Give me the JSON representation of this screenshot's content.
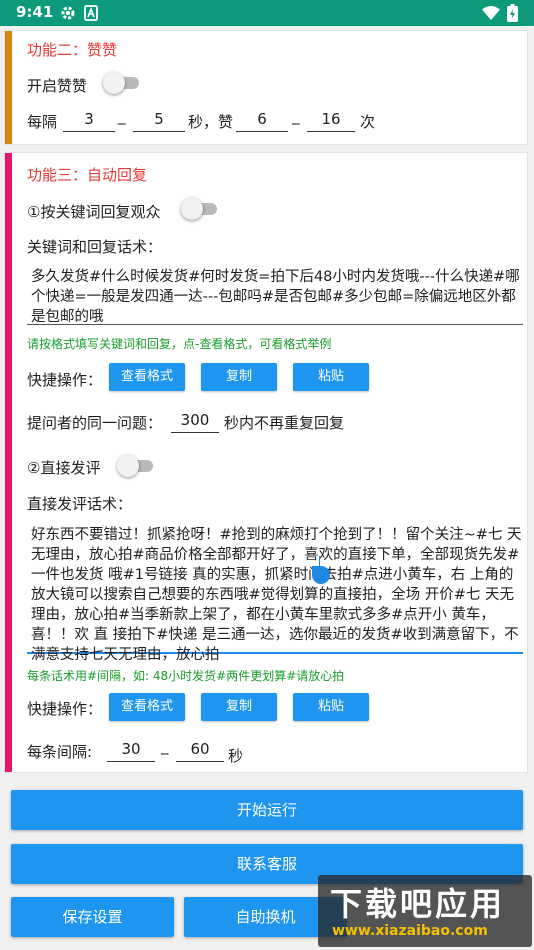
{
  "status_bar": {
    "time": "9:41"
  },
  "feature2": {
    "title": "功能二：赞赞",
    "toggle_label": "开启赞赞",
    "toggle_on": false,
    "interval_prefix": "每隔",
    "min_seconds": "3",
    "max_seconds": "5",
    "separator": "_",
    "seconds_likes_text": "秒，赞",
    "min_likes": "6",
    "max_likes": "16",
    "times_text": "次"
  },
  "feature3": {
    "title": "功能三：自动回复",
    "keyword_toggle_label": "①按关键词回复观众",
    "keyword_toggle_on": false,
    "keyword_label": "关键词和回复话术：",
    "keyword_text": "多久发货#什么时候发货#何时发货=拍下后48小时内发货哦---什么快递#哪个快递=一般是发四通一达---包邮吗#是否包邮#多少包邮=除偏远地区外都是包邮的哦",
    "keyword_hint": "请按格式填写关键词和回复，点-查看格式，可看格式举例",
    "quick_label": "快捷操作：",
    "buttons": {
      "view_format": "查看格式",
      "copy": "复制",
      "paste": "粘贴"
    },
    "same_question_label": "提问者的同一问题：",
    "same_question_seconds": "300",
    "same_question_suffix": "秒内不再重复回复",
    "direct_toggle_label": "②直接发评",
    "direct_toggle_on": false,
    "direct_label": "直接发评话术：",
    "direct_text": "好东西不要错过！抓紧抢呀！#抢到的麻烦打个抢到了！！留个关注~#七 天无理由，放心拍#商品价格全部都开好了，喜欢的直接下单，全部现货先发#一件也发货 哦#1号链接 真的实惠，抓紧时间去拍#点进小黄车，右 上角的放大镜可以搜索自己想要的东西哦#觉得划算的直接拍，全场 开价#七 天无理由，放心拍#当季新款上架了，都在小黄车里款式多多#点开小 黄车，喜！！欢 直 接拍下#快递 是三通一达，选你最近的发货#收到满意留下，不满意支持七天无理由，放心拍",
    "direct_hint": "每条话术用#间隔，如: 48小时发货#两件更划算#请放心拍",
    "quick_label2": "快捷操作：",
    "buttons2": {
      "view_format": "查看格式",
      "copy": "复制",
      "paste": "粘贴"
    },
    "interval_label": "每条间隔:",
    "interval_min": "30",
    "interval_max": "60",
    "interval_suffix": "秒"
  },
  "actions": {
    "start": "开始运行",
    "contact": "联系客服",
    "save": "保存设置",
    "switch_device": "自助换机"
  },
  "watermark": {
    "main": "下载吧应用",
    "url": "www.xiazaibao.com"
  },
  "colors": {
    "status_bar": "#0d9a7a",
    "feature2_bar": "#d4860b",
    "feature3_bar": "#e8156b",
    "title_red": "#e53935",
    "button_blue": "#1e96f0",
    "hint_green": "#1a9e2a",
    "input_underline": "#1e88e5",
    "cursor_handle": "#1e88e5"
  }
}
